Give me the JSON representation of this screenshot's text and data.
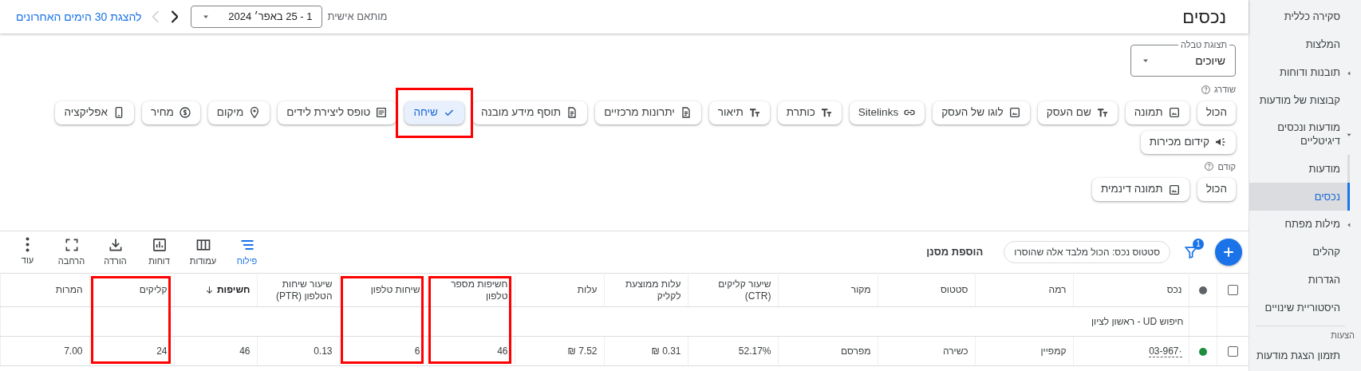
{
  "sidebar": {
    "items": [
      {
        "label": "סקירה כללית",
        "kind": "link",
        "selected": false
      },
      {
        "label": "המלצות",
        "kind": "link",
        "selected": false
      },
      {
        "label": "תובנות ודוחות",
        "kind": "link",
        "selected": false,
        "expanded": false
      },
      {
        "label": "קבוצות של מודעות",
        "kind": "link",
        "selected": false
      },
      {
        "label": "מודעות ונכסים דיגיטליים",
        "kind": "link",
        "selected": false,
        "expanded": true,
        "children": [
          {
            "label": "מודעות",
            "kind": "link",
            "selected": false
          },
          {
            "label": "נכסים",
            "kind": "link",
            "selected": true
          }
        ]
      },
      {
        "label": "מילות מפתח",
        "kind": "link",
        "selected": false,
        "expanded": false
      },
      {
        "label": "קהלים",
        "kind": "link",
        "selected": false
      },
      {
        "label": "הגדרות",
        "kind": "link",
        "selected": false
      },
      {
        "label": "היסטוריית שינויים",
        "kind": "link",
        "selected": false
      },
      {
        "label": "הצעות",
        "kind": "heading"
      },
      {
        "label": "תזמון הצגת מודעות",
        "kind": "link",
        "selected": false
      }
    ]
  },
  "header": {
    "title": "נכסים",
    "date_mode": "מותאם אישית",
    "date_range": "1 - 25 באפר׳ 2024",
    "nav": [
      {
        "kind": "forward",
        "disabled": false
      },
      {
        "kind": "back",
        "disabled": true
      }
    ],
    "last_30_link": "להצגת 30 הימים האחרונים"
  },
  "table_view": {
    "label": "תצוגת טבלה",
    "value": "שיוכים"
  },
  "chip_groups": [
    {
      "label": "שודרג",
      "rows": [
        [
          {
            "label": "הכול",
            "kind": "plain",
            "selected": false,
            "highlighted": false
          },
          {
            "label": "תמונה",
            "kind": "image",
            "selected": false,
            "highlighted": false
          },
          {
            "label": "שם העסק",
            "kind": "text",
            "selected": false,
            "highlighted": false
          },
          {
            "label": "לוגו של העסק",
            "kind": "image",
            "selected": false,
            "highlighted": false
          },
          {
            "label": "Sitelinks",
            "kind": "link",
            "selected": false,
            "highlighted": false
          },
          {
            "label": "כותרת",
            "kind": "text",
            "selected": false,
            "highlighted": false
          },
          {
            "label": "תיאור",
            "kind": "text",
            "selected": false,
            "highlighted": false
          },
          {
            "label": "יתרונות מרכזיים",
            "kind": "doc",
            "selected": false,
            "highlighted": false
          },
          {
            "label": "תוסף מידע מובנה",
            "kind": "doc",
            "selected": false,
            "highlighted": false
          },
          {
            "label": "שיחה",
            "kind": "call",
            "selected": true,
            "highlighted": true
          },
          {
            "label": "טופס ליצירת לידים",
            "kind": "form",
            "selected": false,
            "highlighted": false
          },
          {
            "label": "מיקום",
            "kind": "pin",
            "selected": false,
            "highlighted": false
          },
          {
            "label": "מחיר",
            "kind": "price",
            "selected": false,
            "highlighted": false
          },
          {
            "label": "אפליקציה",
            "kind": "phone",
            "selected": false,
            "highlighted": false
          }
        ],
        [
          {
            "label": "קידום מכירות",
            "kind": "megaphone",
            "selected": false,
            "highlighted": false
          }
        ]
      ]
    },
    {
      "label": "קודם",
      "rows": [
        [
          {
            "label": "הכול",
            "kind": "plain",
            "selected": false,
            "highlighted": false
          },
          {
            "label": "תמונה דינמית",
            "kind": "image",
            "selected": false,
            "highlighted": false
          }
        ]
      ]
    }
  ],
  "toolbar": {
    "filter_count": "1",
    "filter_chip": "סטטוס נכס: הכול מלבד אלה שהוסרו",
    "add_filter": "הוספת מסנן",
    "tools": [
      {
        "label": "פילוח",
        "kind": "segment",
        "selected": true
      },
      {
        "label": "עמודות",
        "kind": "columns",
        "selected": false
      },
      {
        "label": "דוחות",
        "kind": "chart",
        "selected": false
      },
      {
        "label": "הורדה",
        "kind": "download",
        "selected": false
      },
      {
        "label": "הרחבה",
        "kind": "expand",
        "selected": false
      },
      {
        "label": "עוד",
        "kind": "more",
        "selected": false
      }
    ]
  },
  "table": {
    "select_all_checked": false,
    "columns": [
      {
        "label": "נכס",
        "sorted": false,
        "highlighted": false
      },
      {
        "label": "רמה",
        "sorted": false,
        "highlighted": false
      },
      {
        "label": "סטטוס",
        "sorted": false,
        "highlighted": false
      },
      {
        "label": "מקור",
        "sorted": false,
        "highlighted": false
      },
      {
        "label": "שיעור קליקים (CTR)",
        "sorted": false,
        "highlighted": false
      },
      {
        "label": "עלות ממוצעת לקליק",
        "sorted": false,
        "highlighted": false
      },
      {
        "label": "עלות",
        "sorted": false,
        "highlighted": false
      },
      {
        "label": "חשיפות מספר טלפון",
        "sorted": false,
        "highlighted": true
      },
      {
        "label": "שיחות טלפון",
        "sorted": false,
        "highlighted": true
      },
      {
        "label": "שיעור שיחות הטלפון (PTR)",
        "sorted": false,
        "highlighted": false
      },
      {
        "label": "חשיפות",
        "sorted": true,
        "highlighted": false
      },
      {
        "label": "קליקים",
        "sorted": false,
        "highlighted": true
      },
      {
        "label": "המרות",
        "sorted": false,
        "highlighted": false
      }
    ],
    "group_row": "חיפוש UD - ראשון לציון",
    "rows": [
      {
        "checked": false,
        "color": "#1e8e3e",
        "cells": [
          "03-967·",
          "קמפיין",
          "כשירה",
          "מפרסם",
          "52.17%",
          "0.31 ₪",
          "7.52 ₪",
          "46",
          "6",
          "0.13",
          "46",
          "24",
          "7.00"
        ]
      }
    ]
  }
}
